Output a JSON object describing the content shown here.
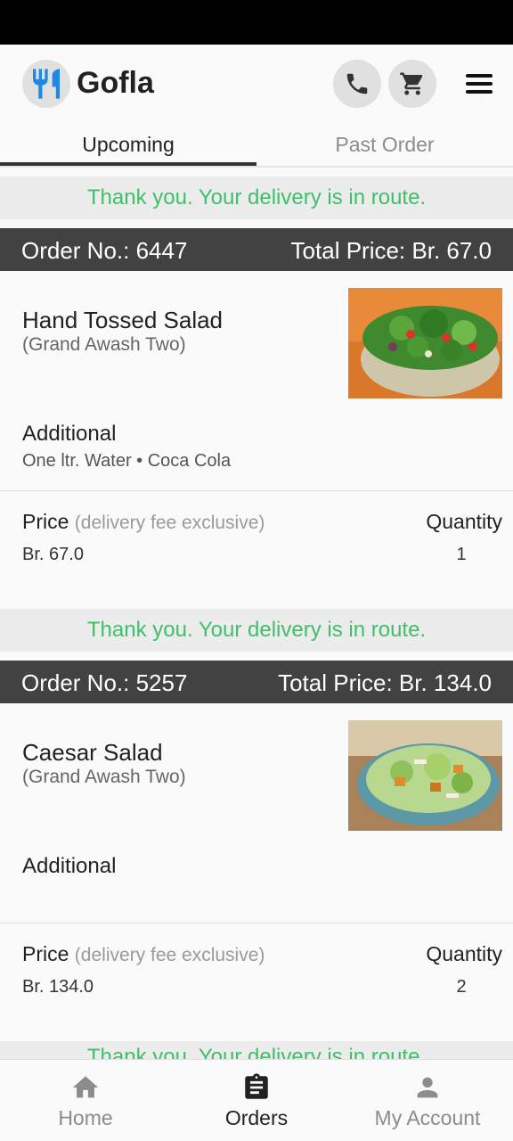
{
  "app": {
    "title": "Gofla"
  },
  "tabs": [
    {
      "label": "Upcoming",
      "active": true
    },
    {
      "label": "Past Order",
      "active": false
    }
  ],
  "orders": [
    {
      "status": "Thank you. Your delivery is in route.",
      "order_no": "Order No.: 6447",
      "total": "Total Price: Br. 67.0",
      "item": "Hand Tossed Salad",
      "restaurant": "(Grand Awash Two)",
      "additional_title": "Additional",
      "additional_items": "One ltr. Water • Coca Cola",
      "price_label": "Price",
      "price_note": "(delivery fee exclusive)",
      "quantity_label": "Quantity",
      "price": "Br. 67.0",
      "quantity": "1"
    },
    {
      "status": "Thank you. Your delivery is in route.",
      "order_no": "Order No.: 5257",
      "total": "Total Price: Br. 134.0",
      "item": "Caesar Salad",
      "restaurant": "(Grand Awash Two)",
      "additional_title": "Additional",
      "additional_items": "",
      "price_label": "Price",
      "price_note": "(delivery fee exclusive)",
      "quantity_label": "Quantity",
      "price": "Br. 134.0",
      "quantity": "2"
    }
  ],
  "next_status": "Thank you. Your delivery is in route.",
  "bottom_nav": [
    {
      "label": "Home",
      "icon": "home-icon",
      "active": false
    },
    {
      "label": "Orders",
      "icon": "orders-icon",
      "active": true
    },
    {
      "label": "My Account",
      "icon": "account-icon",
      "active": false
    }
  ],
  "colors": {
    "brand_blue": "#1e88e5",
    "status_green": "#3fbf6a",
    "header_dark": "#424242"
  }
}
